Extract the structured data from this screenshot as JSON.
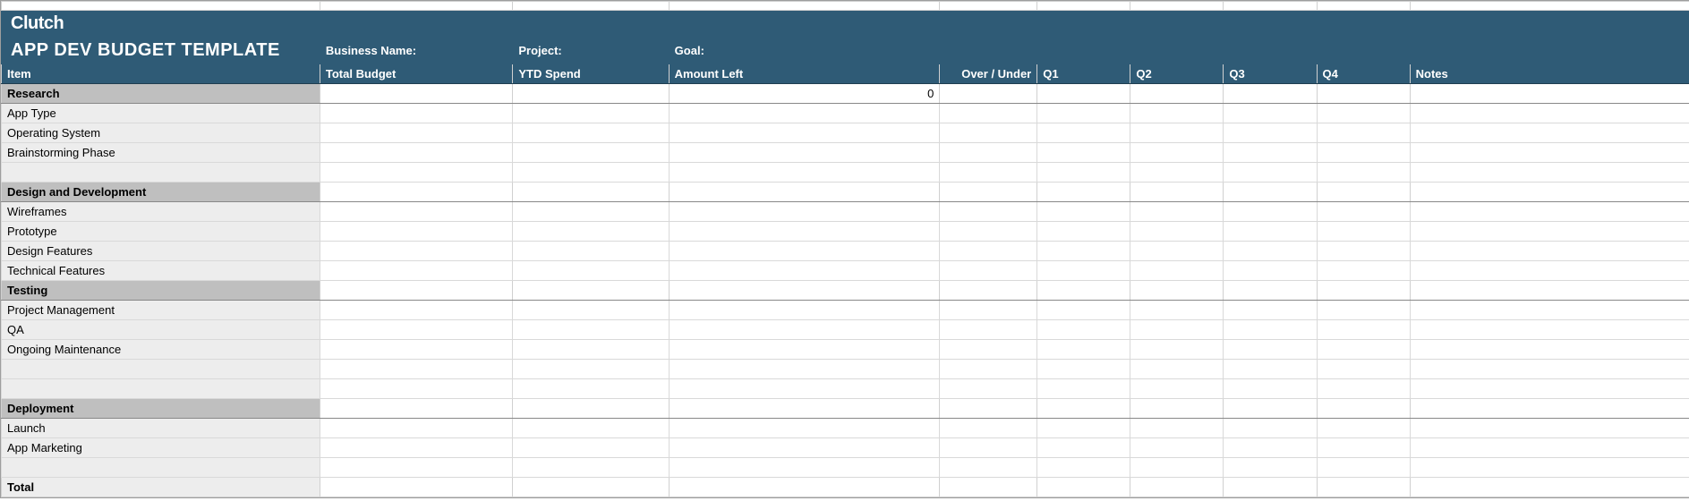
{
  "brand": "Clutch",
  "title": "APP DEV BUDGET TEMPLATE",
  "banner_labels": {
    "business_name": "Business Name:",
    "project": "Project:",
    "goal": "Goal:"
  },
  "columns": {
    "item": "Item",
    "total_budget": "Total Budget",
    "ytd_spend": "YTD Spend",
    "amount_left": "Amount Left",
    "over_under": "Over / Under",
    "q1": "Q1",
    "q2": "Q2",
    "q3": "Q3",
    "q4": "Q4",
    "notes": "Notes"
  },
  "sections": [
    {
      "name": "Research",
      "amount_left": "0",
      "items": [
        "App Type",
        "Operating System",
        "Brainstorming Phase"
      ],
      "trailing_blank": true
    },
    {
      "name": "Design and Development",
      "amount_left": "",
      "items": [
        "Wireframes",
        "Prototype",
        "Design Features",
        "Technical Features"
      ],
      "trailing_blank": false
    },
    {
      "name": "Testing",
      "amount_left": "",
      "items": [
        "Project Management",
        "QA",
        "Ongoing Maintenance"
      ],
      "trailing_blank": true,
      "extra_blank": true
    },
    {
      "name": "Deployment",
      "amount_left": "",
      "items": [
        "Launch",
        "App Marketing"
      ],
      "trailing_blank": true
    }
  ],
  "total_label": "Total"
}
